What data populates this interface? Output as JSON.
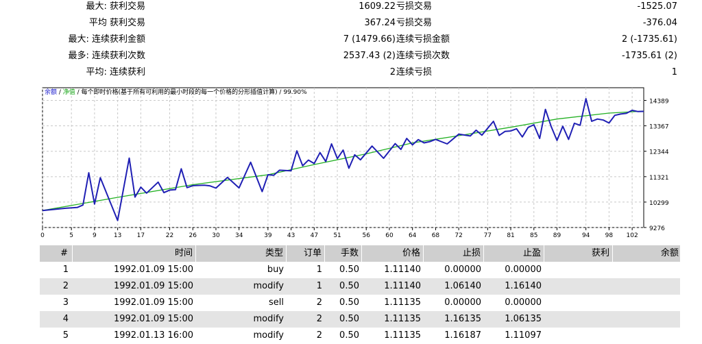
{
  "summary": [
    {
      "label": "最大:  获利交易",
      "value": "1609.22",
      "label2": "亏损交易",
      "value2": "-1525.07"
    },
    {
      "label": "平均  获利交易",
      "value": "367.24",
      "label2": "亏损交易",
      "value2": "-376.04"
    },
    {
      "label": "最大:  连续获利金额",
      "value": "7 (1479.66)",
      "label2": "连续亏损金额",
      "value2": "2 (-1735.61)"
    },
    {
      "label": "最多:  连续获利次数",
      "value": "2537.43 (2)",
      "label2": "连续亏损次数",
      "value2": "-1735.61 (2)"
    },
    {
      "label": "平均:  连续获利",
      "value": "2",
      "label2": "连续亏损",
      "value2": "1"
    }
  ],
  "chart": {
    "legend_balance": "余额",
    "legend_sep1": " / ",
    "legend_equity": "净值",
    "legend_rest": " / 每个即时价格(基于所有可利用的最小时段的每一个价格的分形插值计算) / 99.90%",
    "colors": {
      "balance": "#1f1fb4",
      "equity": "#22b022",
      "grid": "#c8c8c8",
      "axis": "#000000"
    }
  },
  "chart_data": {
    "type": "line",
    "ylim": [
      9276,
      14900
    ],
    "xlim": [
      0,
      104
    ],
    "y_ticks": [
      9276,
      10299,
      11321,
      12344,
      13367,
      14389
    ],
    "x_ticks": [
      0,
      5,
      9,
      13,
      17,
      22,
      26,
      30,
      34,
      39,
      43,
      47,
      51,
      56,
      60,
      64,
      68,
      72,
      77,
      81,
      85,
      89,
      94,
      98,
      102
    ],
    "grid": true,
    "series": [
      {
        "name": "余额",
        "values": [
          [
            0,
            9960
          ],
          [
            4,
            10050
          ],
          [
            6,
            10080
          ],
          [
            7,
            10180
          ],
          [
            8,
            11480
          ],
          [
            9,
            10220
          ],
          [
            10,
            11280
          ],
          [
            13,
            9560
          ],
          [
            15,
            12070
          ],
          [
            16,
            10500
          ],
          [
            17,
            10900
          ],
          [
            18,
            10660
          ],
          [
            20,
            11100
          ],
          [
            21,
            10680
          ],
          [
            22,
            10780
          ],
          [
            23,
            10800
          ],
          [
            24,
            11640
          ],
          [
            25,
            10880
          ],
          [
            26,
            10960
          ],
          [
            28,
            10980
          ],
          [
            29,
            10950
          ],
          [
            30,
            10860
          ],
          [
            32,
            11290
          ],
          [
            34,
            10870
          ],
          [
            36,
            11900
          ],
          [
            38,
            10720
          ],
          [
            39,
            11400
          ],
          [
            40,
            11380
          ],
          [
            41,
            11580
          ],
          [
            43,
            11560
          ],
          [
            44,
            12360
          ],
          [
            45,
            11760
          ],
          [
            46,
            11990
          ],
          [
            47,
            11850
          ],
          [
            48,
            12290
          ],
          [
            49,
            11930
          ],
          [
            50,
            12640
          ],
          [
            51,
            12050
          ],
          [
            52,
            12390
          ],
          [
            53,
            11660
          ],
          [
            54,
            12200
          ],
          [
            55,
            12000
          ],
          [
            57,
            12550
          ],
          [
            59,
            12060
          ],
          [
            61,
            12650
          ],
          [
            62,
            12420
          ],
          [
            63,
            12860
          ],
          [
            64,
            12600
          ],
          [
            65,
            12810
          ],
          [
            66,
            12680
          ],
          [
            67,
            12730
          ],
          [
            68,
            12820
          ],
          [
            70,
            12640
          ],
          [
            72,
            13030
          ],
          [
            74,
            12960
          ],
          [
            75,
            13190
          ],
          [
            76,
            12990
          ],
          [
            78,
            13550
          ],
          [
            79,
            12980
          ],
          [
            80,
            13140
          ],
          [
            81,
            13160
          ],
          [
            82,
            13250
          ],
          [
            83,
            12920
          ],
          [
            84,
            13300
          ],
          [
            85,
            13410
          ],
          [
            86,
            12860
          ],
          [
            87,
            14030
          ],
          [
            88,
            13330
          ],
          [
            89,
            12780
          ],
          [
            90,
            13350
          ],
          [
            91,
            12820
          ],
          [
            92,
            13470
          ],
          [
            93,
            13390
          ],
          [
            94,
            14460
          ],
          [
            95,
            13550
          ],
          [
            96,
            13640
          ],
          [
            97,
            13600
          ],
          [
            98,
            13480
          ],
          [
            99,
            13790
          ],
          [
            100,
            13840
          ],
          [
            101,
            13870
          ],
          [
            102,
            13990
          ],
          [
            103,
            13940
          ],
          [
            104,
            13950
          ]
        ]
      },
      {
        "name": "净值",
        "values": [
          [
            0,
            9960
          ],
          [
            13,
            10490
          ],
          [
            26,
            11000
          ],
          [
            39,
            11400
          ],
          [
            47,
            11810
          ],
          [
            56,
            12240
          ],
          [
            64,
            12680
          ],
          [
            72,
            12970
          ],
          [
            81,
            13310
          ],
          [
            89,
            13640
          ],
          [
            98,
            13880
          ],
          [
            104,
            13960
          ]
        ]
      }
    ]
  },
  "table": {
    "headers": [
      "#",
      "时间",
      "类型",
      "订单",
      "手数",
      "价格",
      "止损",
      "止盈",
      "获利",
      "余额"
    ],
    "rows": [
      [
        "1",
        "1992.01.09 15:00",
        "buy",
        "1",
        "0.50",
        "1.11140",
        "0.00000",
        "0.00000",
        "",
        ""
      ],
      [
        "2",
        "1992.01.09 15:00",
        "modify",
        "1",
        "0.50",
        "1.11140",
        "1.06140",
        "1.16140",
        "",
        ""
      ],
      [
        "3",
        "1992.01.09 15:00",
        "sell",
        "2",
        "0.50",
        "1.11135",
        "0.00000",
        "0.00000",
        "",
        ""
      ],
      [
        "4",
        "1992.01.09 15:00",
        "modify",
        "2",
        "0.50",
        "1.11135",
        "1.16135",
        "1.06135",
        "",
        ""
      ],
      [
        "5",
        "1992.01.13 16:00",
        "modify",
        "2",
        "0.50",
        "1.11135",
        "1.16187",
        "1.11097",
        "",
        ""
      ]
    ]
  }
}
